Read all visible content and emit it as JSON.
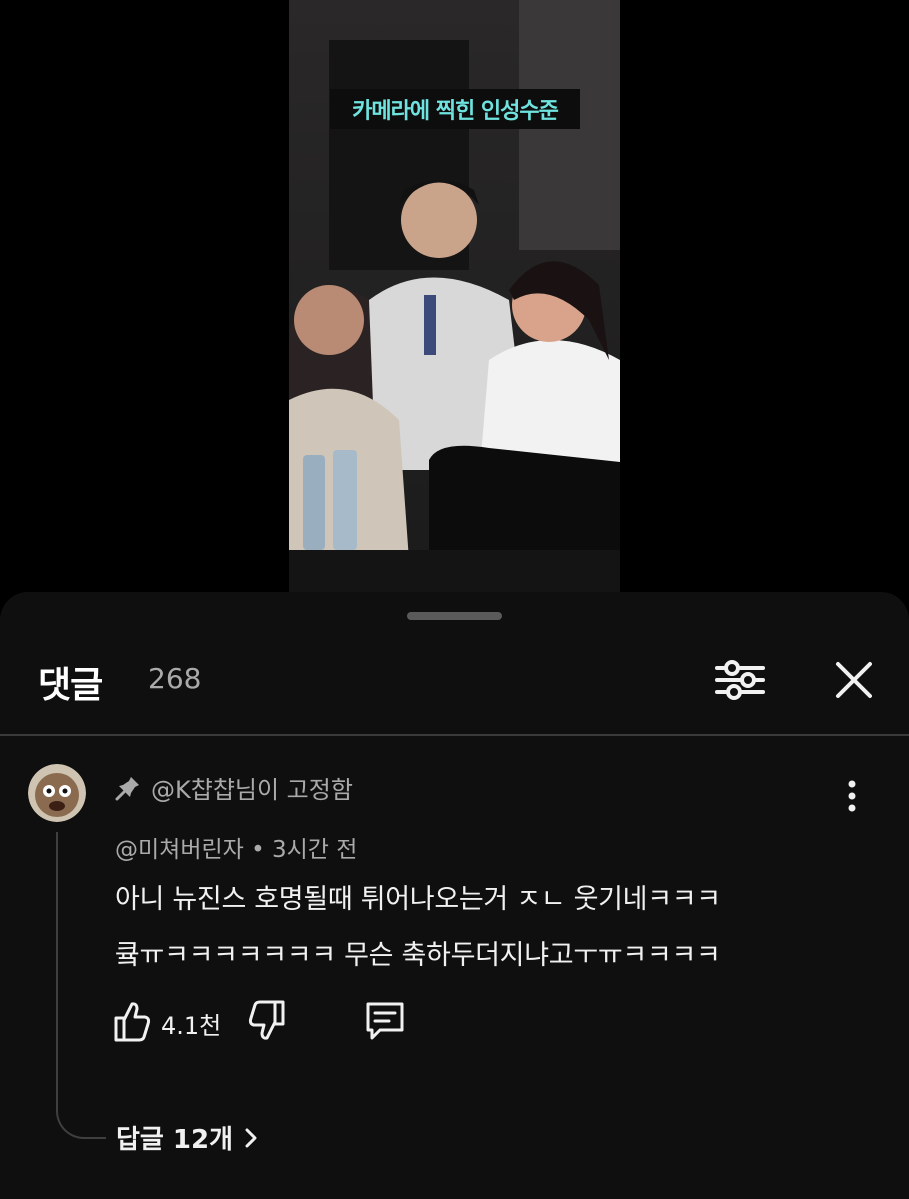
{
  "video": {
    "caption": "카메라에 찍힌 인성수준"
  },
  "comments_panel": {
    "title": "댓글",
    "count": "268",
    "icons": {
      "filter": "sort-filter-icon",
      "close": "close-icon"
    }
  },
  "comment": {
    "pinned_text": "@K챱챱님이 고정함",
    "author": "@미쳐버린자",
    "separator": " • ",
    "time": "3시간 전",
    "text_line1": "아니 뉴진스 호명될때 튀어나오는거 ㅈㄴ 웃기네ㅋㅋㅋ",
    "text_line2": "큨ㅠㅋㅋㅋㅋㅋㅋㅋ 무슨 축하두더지냐고ㅜㅠㅋㅋㅋㅋ",
    "likes": "4.1천",
    "replies_label": "답글 12개"
  },
  "colors": {
    "background": "#000000",
    "sheet": "#0f0f0f",
    "caption_text": "#6fe3df",
    "secondary_text": "#aaaaaa"
  }
}
